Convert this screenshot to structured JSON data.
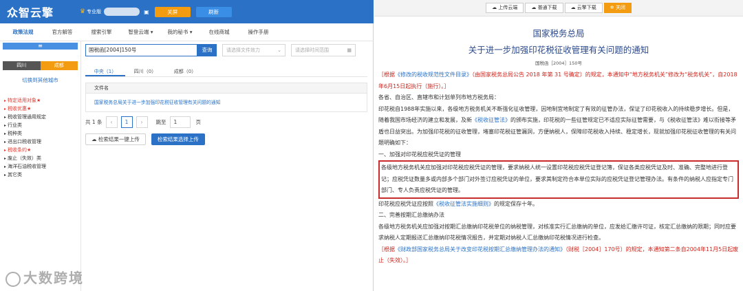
{
  "app": {
    "logo": "众智云擎",
    "vip_label": "专业版",
    "close_label": "关屏",
    "refresh_label": "刷新"
  },
  "nav": [
    "政策法规",
    "官方解答",
    "搜索引擎",
    "智登云端 ▾",
    "我的秘书 ▾",
    "在线商城",
    "操作手册"
  ],
  "sidebar": {
    "collapse_label": "≡",
    "region_left": "四川",
    "region_right": "成都",
    "switch_label": "切换到其他城市",
    "tree": [
      {
        "label": "特定适用对象★",
        "red": true
      },
      {
        "label": "税收优惠★",
        "red": true
      },
      {
        "label": "税收管理通用规定",
        "red": false
      },
      {
        "label": "行业类",
        "red": false
      },
      {
        "label": "税种类",
        "red": false
      },
      {
        "label": "进出口税收管理",
        "red": false
      },
      {
        "label": "税收条约★",
        "red": true
      },
      {
        "label": "废止（失效）类",
        "red": false
      },
      {
        "label": "海洋石油税收管理",
        "red": false
      },
      {
        "label": "其它类",
        "red": false
      }
    ]
  },
  "search": {
    "query": "国税函[2004]150号",
    "button": "查询",
    "effect_placeholder": "请选择文件效力",
    "time_placeholder": "请选择时间范围"
  },
  "tabs": [
    "中央（1）",
    "四川（0）",
    "成都（0）"
  ],
  "table": {
    "header": "文件名",
    "rows": [
      "国家税务总局关于进一步加强印花税征收管理有关问题的通知"
    ]
  },
  "pager": {
    "total": "共 1 条",
    "prev": "‹",
    "current": "1",
    "next": "›",
    "jump_label": "跳至",
    "jump_value": "1",
    "unit": "页"
  },
  "upload": {
    "all_label": "检索结果一键上传",
    "selected_label": "检索结果选择上传"
  },
  "doc_toolbar": {
    "upload_cloud": "上传云端",
    "normal_download": "普通下载",
    "cloud_download": "云擎下载",
    "close": "关闭"
  },
  "doc": {
    "org": "国家税务总局",
    "title": "关于进一步加强印花税征收管理有关问题的通知",
    "number": "国税函［2004］150号",
    "note1_prefix": "［根据",
    "note1_link": "《修改的税收规范性文件目录》",
    "note1_suffix": "（由国家税务总局公告 2018 年第 31 号确定）的规定，本通知中“地方税务机关”修改为“税务机关”，自2018年6月15日起执行（施行）。］",
    "salutation": "各省、自治区、直辖市和计划单列市地方税务局：",
    "intro_a": "印花税自1988年实施以来，各级地方税务机关不断强化征收管理，因地制宜地制定了有效的征管办法，保证了印花税收入的持续稳步增长。但是，随着我国市场经济的建立和发展，及新",
    "intro_link": "《税收征管法》",
    "intro_b": "的颁布实施，印花税的一些征管规定已不适应实际征管需要，与《税收征管法》难以衔接等矛盾也日益突出。为加强印花税的征收管理，堵塞印花税征管漏洞，方便纳税人，保障印花税收入持续、稳定增长，现就加强印花税征收管理的有关问题明确如下：",
    "section1": "一、加强对印花税应税凭证的管理",
    "highlight": "各级地方税务机关应加强对印花税应税凭证的管理，要求纳税人统一设置印花税应税凭证登记簿，保证各类应税凭证及时、准确、完整地进行登记；应税凭证数量多或内部多个部门对外签订应税凭证的单位，要求其制定符合本单位实际的应税凭证登记管理办法。有条件的纳税人应指定专门部门、专人负责应税凭证的管理。",
    "keep_a": "印花税应税凭证应按照",
    "keep_link": "《税收征管法实施细则》",
    "keep_b": "的规定保存十年。",
    "section2": "二、完善按期汇总缴纳办法",
    "section2_text": "各级地方税务机关应加强对按期汇总缴纳印花税单位的纳税管理，对核准实行汇总缴纳的单位，应发给汇缴许可证，核定汇总缴纳的限期；同时应要求纳税人定期报送汇总缴纳印花税情况报告，并定期对纳税人汇总缴纳印花税情况进行检查。",
    "note2_prefix": "［根据",
    "note2_link": "《财政部国家税务总局关于改变印花税按期汇总缴纳管理办法的通知》",
    "note2_suffix": "（财税［2004］170号）的规定，本通知第二条自2004年11月5日起废止（失效）。］"
  },
  "watermark": "大数跨境"
}
